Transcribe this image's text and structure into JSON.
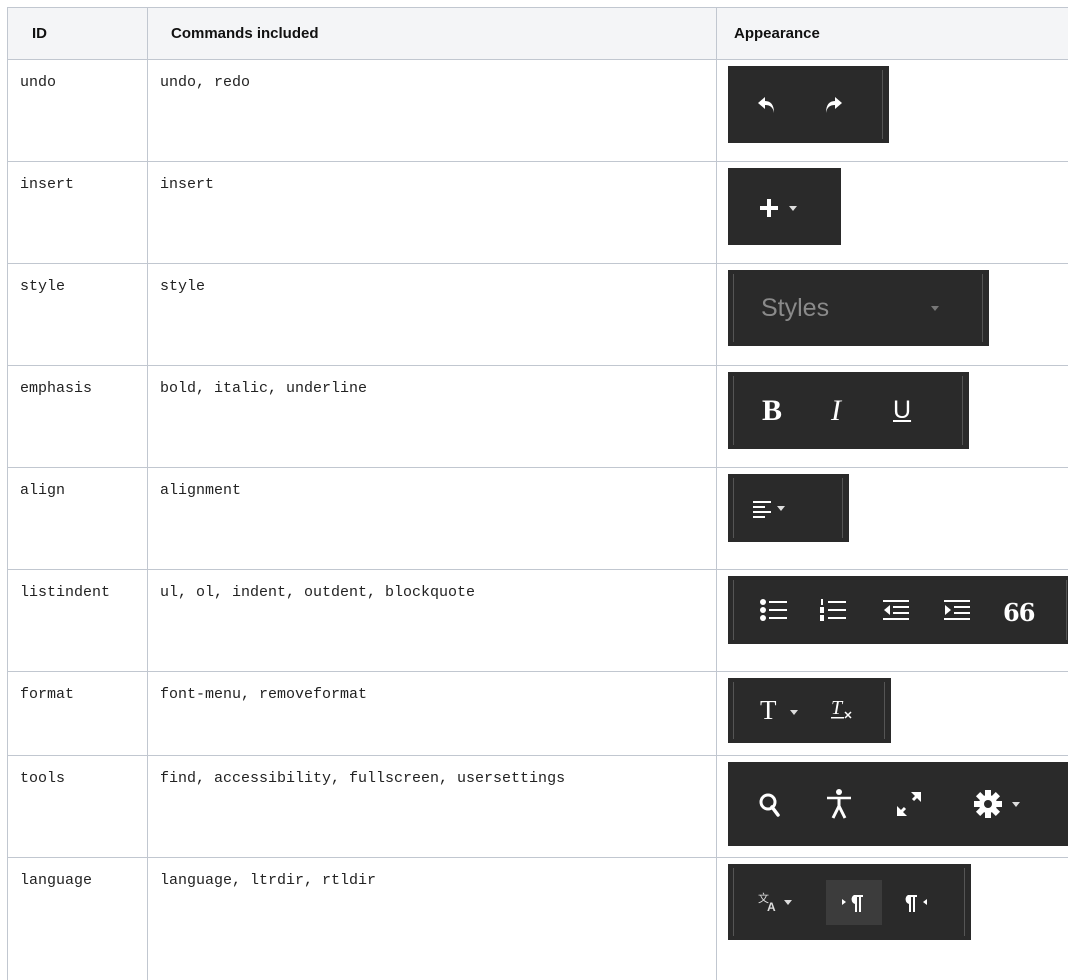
{
  "headers": {
    "id": "ID",
    "commands": "Commands included",
    "appearance": "Appearance"
  },
  "rows": [
    {
      "id": "undo",
      "commands": "undo, redo",
      "appearance": [
        "undo-icon",
        "redo-icon"
      ]
    },
    {
      "id": "insert",
      "commands": "insert",
      "appearance": [
        "plus-icon",
        "chevron-down-icon"
      ]
    },
    {
      "id": "style",
      "commands": "style",
      "appearance": [
        "Styles",
        "chevron-down-icon"
      ]
    },
    {
      "id": "emphasis",
      "commands": "bold, italic, underline",
      "appearance": [
        "B",
        "I",
        "U"
      ]
    },
    {
      "id": "align",
      "commands": "alignment",
      "appearance": [
        "align-left-icon",
        "chevron-down-icon"
      ]
    },
    {
      "id": "listindent",
      "commands": "ul, ol, indent, outdent, blockquote",
      "appearance": [
        "bullet-list-icon",
        "numbered-list-icon",
        "outdent-icon",
        "indent-icon",
        "blockquote-icon"
      ]
    },
    {
      "id": "format",
      "commands": "font-menu, removeformat",
      "appearance": [
        "T",
        "chevron-down-icon",
        "remove-format-icon"
      ]
    },
    {
      "id": "tools",
      "commands": "find, accessibility, fullscreen, usersettings",
      "appearance": [
        "search-icon",
        "accessibility-icon",
        "fullscreen-icon",
        "gear-icon",
        "chevron-down-icon"
      ]
    },
    {
      "id": "language",
      "commands": "language, ltrdir, rtldir",
      "appearance": [
        "translate-icon",
        "chevron-down-icon",
        "ltr-paragraph-icon",
        "rtl-paragraph-icon"
      ]
    }
  ],
  "toolbar": {
    "styles_label": "Styles",
    "bold_label": "B",
    "italic_label": "I",
    "underline_label": "U",
    "font_label": "T",
    "blockquote_glyph": "66",
    "background": "#2a2a2a",
    "icon_color": "#ffffff"
  }
}
